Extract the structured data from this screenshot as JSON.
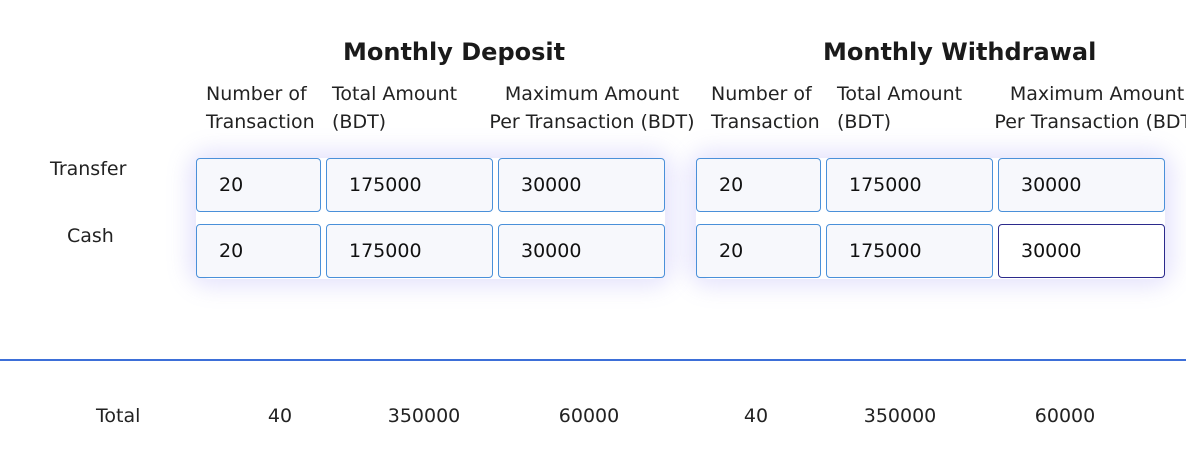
{
  "deposit": {
    "title": "Monthly Deposit",
    "headers": {
      "count": [
        "Number of",
        "Transaction"
      ],
      "total": [
        "Total Amount",
        "(BDT)"
      ],
      "max": [
        "Maximum Amount",
        "Per Transaction (BDT)"
      ]
    },
    "transfer": {
      "count": "20",
      "total": "175000",
      "max": "30000"
    },
    "cash": {
      "count": "20",
      "total": "175000",
      "max": "30000"
    },
    "totals": {
      "count": "40",
      "total": "350000",
      "max": "60000"
    }
  },
  "withdrawal": {
    "title": "Monthly Withdrawal",
    "headers": {
      "count": [
        "Number of",
        "Transaction"
      ],
      "total": [
        "Total Amount",
        "(BDT)"
      ],
      "max": [
        "Maximum Amount",
        "Per Transaction (BDT)"
      ]
    },
    "transfer": {
      "count": "20",
      "total": "175000",
      "max": "30000"
    },
    "cash": {
      "count": "20",
      "total": "175000",
      "max": "30000"
    },
    "totals": {
      "count": "40",
      "total": "350000",
      "max": "60000"
    }
  },
  "rows": {
    "transfer_label": "Transfer",
    "cash_label": "Cash",
    "total_label": "Total"
  }
}
